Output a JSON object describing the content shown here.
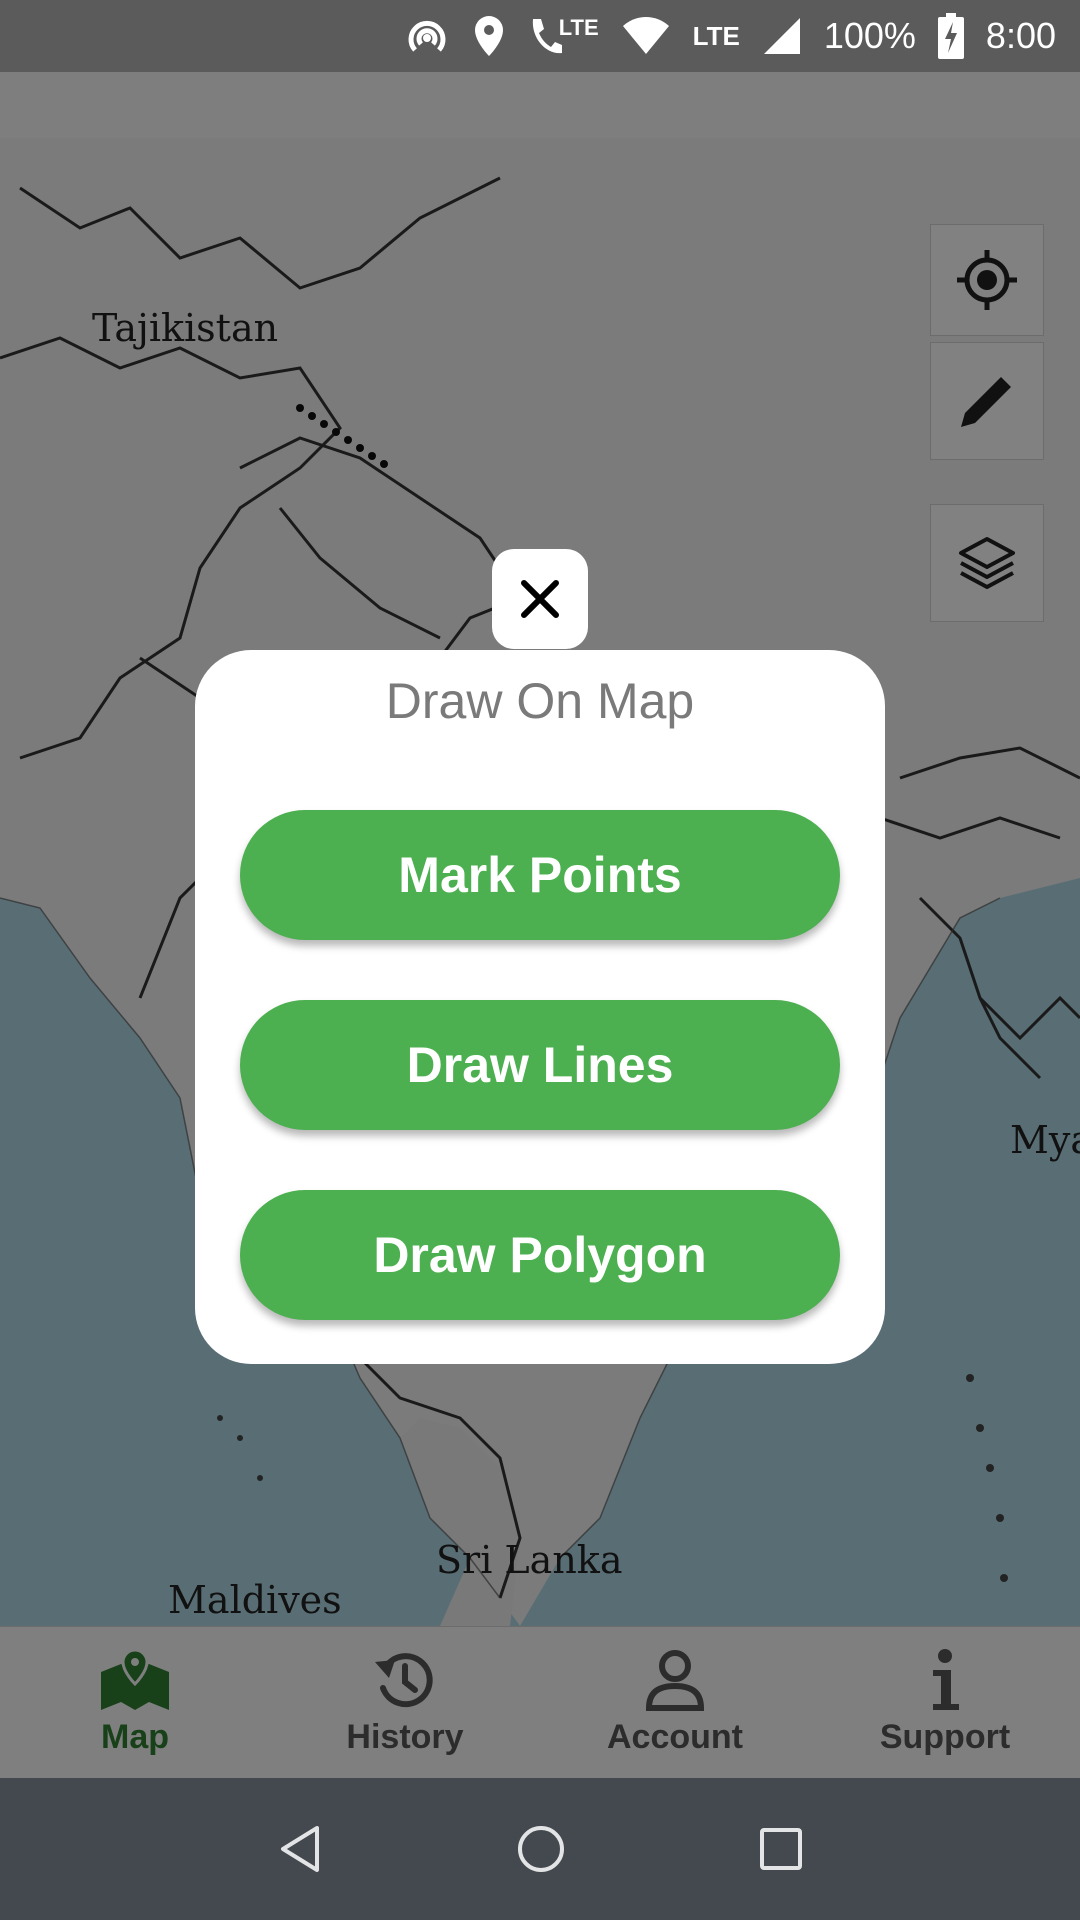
{
  "status_bar": {
    "lte_call": "LTE",
    "lte_data": "LTE",
    "battery": "100%",
    "time": "8:00",
    "icons": [
      "hotspot-icon",
      "location-icon",
      "volte-call-icon",
      "wifi-icon",
      "signal-icon",
      "battery-charging-icon"
    ]
  },
  "map": {
    "labels": {
      "tajikistan": "Tajikistan",
      "sri_lanka": "Sri Lanka",
      "maldives": "Maldives",
      "myanmar_partial": "Mya"
    },
    "controls": [
      "my-location-icon",
      "pencil-icon",
      "layers-icon"
    ]
  },
  "dialog": {
    "title": "Draw On Map",
    "buttons": {
      "mark_points": "Mark Points",
      "draw_lines": "Draw Lines",
      "draw_polygon": "Draw Polygon"
    },
    "close_icon": "close-icon"
  },
  "bottom_nav": {
    "items": [
      {
        "label": "Map",
        "icon": "map-icon",
        "active": true
      },
      {
        "label": "History",
        "icon": "history-icon",
        "active": false
      },
      {
        "label": "Account",
        "icon": "account-icon",
        "active": false
      },
      {
        "label": "Support",
        "icon": "info-icon",
        "active": false
      }
    ]
  },
  "system_nav": [
    "back-icon",
    "home-icon",
    "recents-icon"
  ],
  "colors": {
    "accent_green": "#4caf50",
    "active_nav": "#2e7d32",
    "water": "#aad3df",
    "system_nav_bg": "#43494f"
  }
}
